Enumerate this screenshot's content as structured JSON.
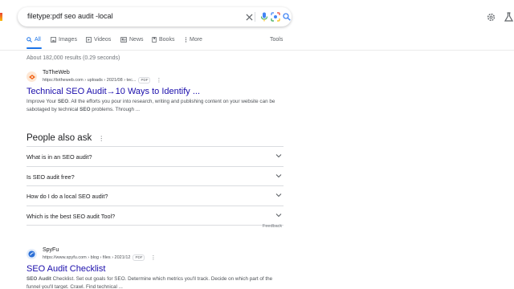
{
  "search": {
    "query": "filetype:pdf seo audit -local"
  },
  "tabs": [
    {
      "label": "All",
      "icon": "search-icon"
    },
    {
      "label": "Images",
      "icon": "image-icon"
    },
    {
      "label": "Videos",
      "icon": "video-icon"
    },
    {
      "label": "News",
      "icon": "news-icon"
    },
    {
      "label": "Books",
      "icon": "book-icon"
    },
    {
      "label": "More",
      "icon": "more-vert-icon"
    }
  ],
  "tools_label": "Tools",
  "stats": "About 182,000 results (0.29 seconds)",
  "results": [
    {
      "site_name": "ToTheWeb",
      "url": "https://totheweb.com › uploads › 2021/08 › tec...",
      "badge": "PDF",
      "title": "Technical SEO Audit→10 Ways to Identify ...",
      "snippet_parts": [
        "Improve Your ",
        "SEO",
        ". All the efforts you pour into research, writing and publishing content on your website can be sabotaged by technical ",
        "SEO",
        " problems. Through ..."
      ]
    },
    {
      "site_name": "SpyFu",
      "url": "https://www.spyfu.com › blog › files › 2021/12",
      "badge": "PDF",
      "title": "SEO Audit Checklist",
      "snippet_parts": [
        "SEO Audit",
        " Checklist. Set out goals for SEO. Determine which metrics you'll track. Decide on which part of the funnel you'll target. Crawl. Find technical ..."
      ]
    }
  ],
  "paa": {
    "heading": "People also ask",
    "questions": [
      "What is in an SEO audit?",
      "Is SEO audit free?",
      "How do I do a local SEO audit?",
      "Which is the best SEO audit Tool?"
    ],
    "feedback": "Feedback"
  },
  "colors": {
    "link": "#1a0dab",
    "accent": "#1a73e8",
    "favicon_totheweb": "#f6a15a",
    "favicon_spyfu": "#2b6fd6"
  }
}
